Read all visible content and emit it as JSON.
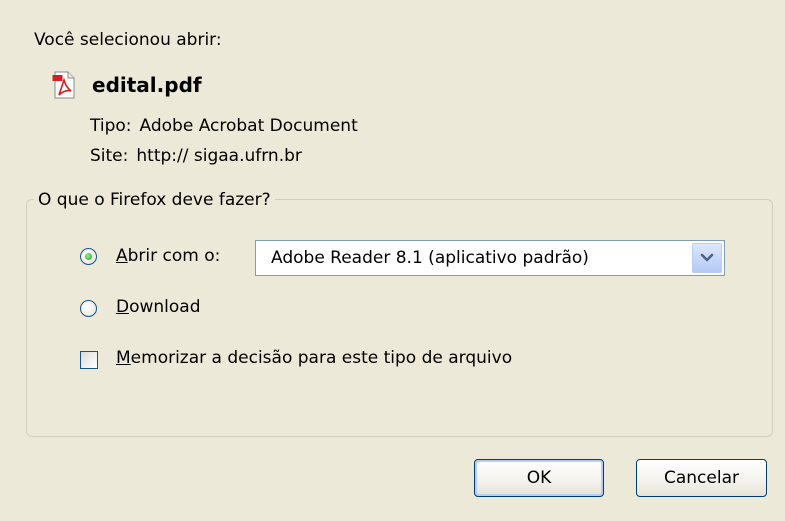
{
  "dialog": {
    "intro": "Você selecionou abrir:",
    "file_name": "edital.pdf",
    "type_label": "Tipo:",
    "type_value": "Adobe Acrobat Document",
    "site_label": "Site:",
    "site_value": "http:// sigaa.ufrn.br",
    "file_icon": "pdf-icon"
  },
  "action_group": {
    "legend": "O que o Firefox deve fazer?",
    "open_with": {
      "access_key": "A",
      "label_rest": "brir com o:",
      "selected": true
    },
    "app_select": {
      "value": "Adobe Reader 8.1 (aplicativo padrão)"
    },
    "download": {
      "access_key": "D",
      "label_rest": "ownload",
      "selected": false
    },
    "remember": {
      "access_key": "M",
      "label_rest": "emorizar a decisão para este tipo de arquivo",
      "checked": false
    }
  },
  "buttons": {
    "ok": "OK",
    "cancel": "Cancelar"
  }
}
